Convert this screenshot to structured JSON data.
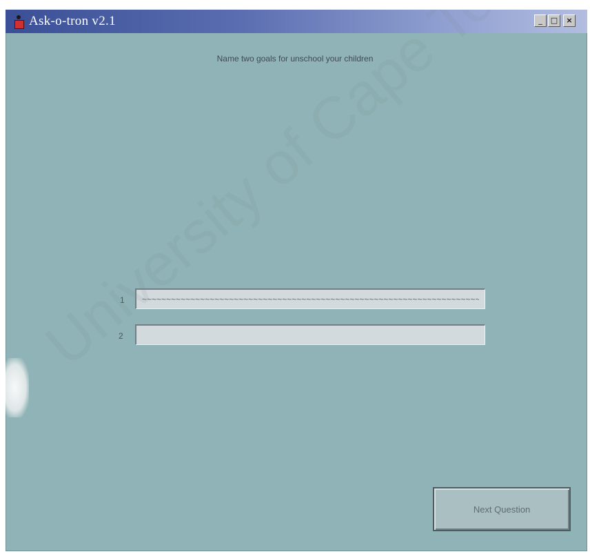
{
  "window": {
    "title": "Ask-o-tron v2.1",
    "controls": {
      "minimize": "_",
      "maximize": "□",
      "close": "×"
    }
  },
  "main": {
    "question": "Name two goals for unschool your children",
    "rows": [
      {
        "label": "1",
        "value": "~~~~~~~~~~~~~~~~~~~~~~~~~~~~~~~~~~~~~~~~~~~~~~~~~~~~~~~~~~~~~~~~~~~~~~~"
      },
      {
        "label": "2",
        "value": ""
      }
    ],
    "next_button": "Next Question"
  },
  "watermark": "University of Cape Town",
  "colors": {
    "window_bg": "#8fb3b6",
    "titlebar_start": "#3a4f96",
    "titlebar_end": "#b2bde0",
    "input_bg": "#d3dade"
  },
  "icons": {
    "app": "person-icon",
    "minimize": "minimize-icon",
    "maximize": "maximize-icon",
    "close": "close-icon"
  }
}
